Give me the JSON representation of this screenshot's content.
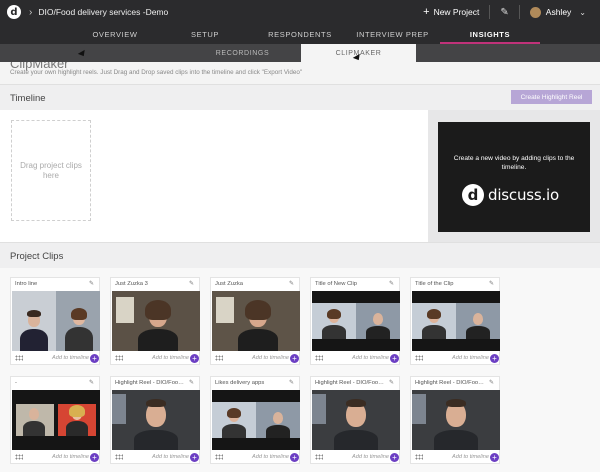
{
  "topbar": {
    "project_title": "DIO/Food delivery services -Demo",
    "new_project_label": "New Project",
    "user_name": "Ashley"
  },
  "mainnav": {
    "tabs": [
      "OVERVIEW",
      "SETUP",
      "RESPONDENTS",
      "INTERVIEW PREP",
      "INSIGHTS"
    ],
    "active": "INSIGHTS",
    "accent_color": "#c0327a"
  },
  "subnav": {
    "tabs": [
      "RECORDINGS",
      "CLIPMAKER"
    ],
    "active": "CLIPMAKER"
  },
  "page": {
    "title": "ClipMaker",
    "subtitle": "Create your own highlight reels. Just Drag and Drop saved clips into the timeline and click \"Export Video\""
  },
  "timeline": {
    "title": "Timeline",
    "create_button": "Create Highlight Reel",
    "create_button_color": "#b7a6d6",
    "dropzone_text": "Drag project clips here",
    "preview_message": "Create a new video by adding clips to the timeline.",
    "preview_logo": "discuss.io"
  },
  "project_clips": {
    "title": "Project Clips",
    "add_label": "Add to timeline",
    "add_color": "#6c3fc3",
    "clips": [
      {
        "name": "Intro line"
      },
      {
        "name": "Just Zuzka 3"
      },
      {
        "name": "Just Zuzka"
      },
      {
        "name": "Title of New Clip"
      },
      {
        "name": "Title of the Clip"
      },
      {
        "name": "-"
      },
      {
        "name": "Highlight Reel - DIO/Food delivery"
      },
      {
        "name": "Likes delivery apps"
      },
      {
        "name": "Highlight Reel - DIO/Food delivery"
      },
      {
        "name": "Highlight Reel - DIO/Food delivery"
      }
    ]
  }
}
